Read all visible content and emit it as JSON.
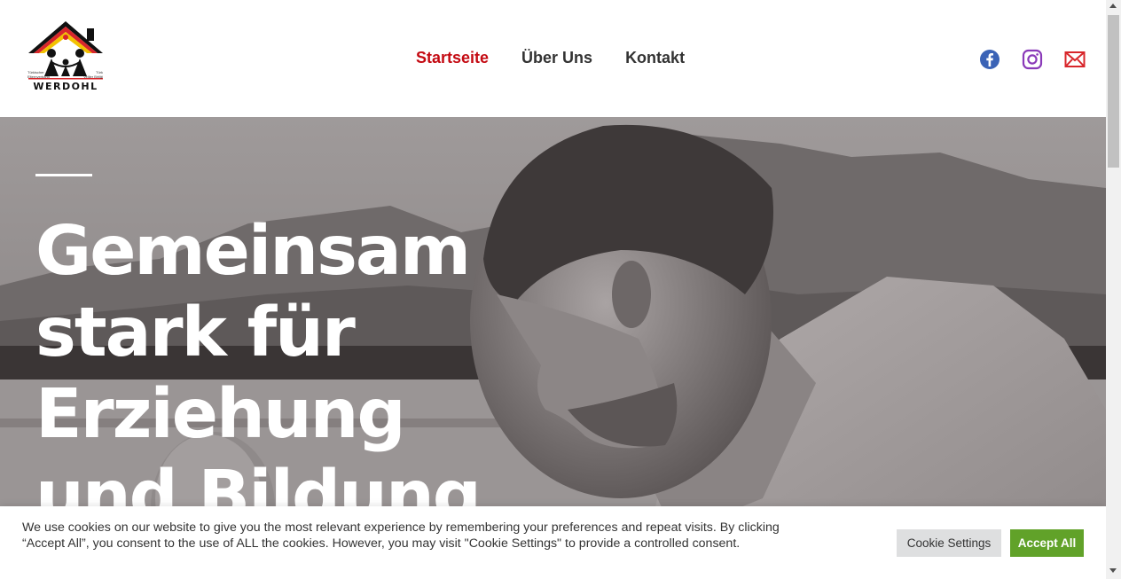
{
  "logo": {
    "name": "WERDOHL",
    "small_left": "Türkischer\nElternverband",
    "small_right": "Türk\nVeliler Birliği"
  },
  "nav": {
    "items": [
      {
        "label": "Startseite",
        "active": true
      },
      {
        "label": "Über Uns",
        "active": false
      },
      {
        "label": "Kontakt",
        "active": false
      }
    ]
  },
  "social": [
    "facebook-icon",
    "instagram-icon",
    "email-icon"
  ],
  "hero": {
    "title": "Gemeinsam\nstark für\nErziehung\nund Bildung"
  },
  "cookie": {
    "text": "We use cookies on our website to give you the most relevant experience by remembering your preferences and repeat visits. By clicking “Accept All”, you consent to the use of ALL the cookies. However, you may visit \"Cookie Settings\" to provide a controlled consent.",
    "settings_label": "Cookie Settings",
    "accept_label": "Accept All"
  },
  "colors": {
    "accent": "#c40a12",
    "accept": "#61a229",
    "facebook": "#3b63b6",
    "instagram": "#8a3ab9",
    "email": "#d8262b"
  }
}
